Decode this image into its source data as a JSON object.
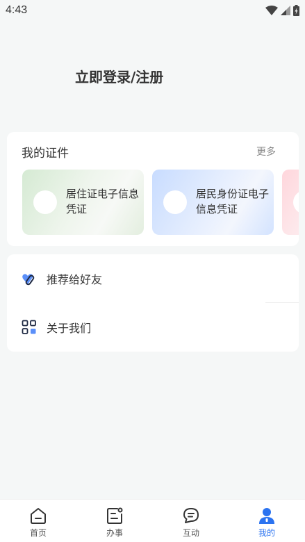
{
  "status_bar": {
    "time": "4:43"
  },
  "header": {
    "login_title": "立即登录/注册"
  },
  "certificates": {
    "title": "我的证件",
    "more_label": "更多",
    "items": [
      {
        "label": "居住证电子信息凭证"
      },
      {
        "label": "居民身份证电子信息凭证"
      }
    ]
  },
  "menu": {
    "items": [
      {
        "label": "推荐给好友",
        "icon": "heart-link-icon"
      },
      {
        "label": "关于我们",
        "icon": "grid-apps-icon"
      }
    ]
  },
  "tab_bar": {
    "active_color": "#2b73f0",
    "items": [
      {
        "label": "首页",
        "icon": "home-icon"
      },
      {
        "label": "办事",
        "icon": "service-icon"
      },
      {
        "label": "互动",
        "icon": "chat-icon"
      },
      {
        "label": "我的",
        "icon": "user-icon"
      }
    ]
  }
}
